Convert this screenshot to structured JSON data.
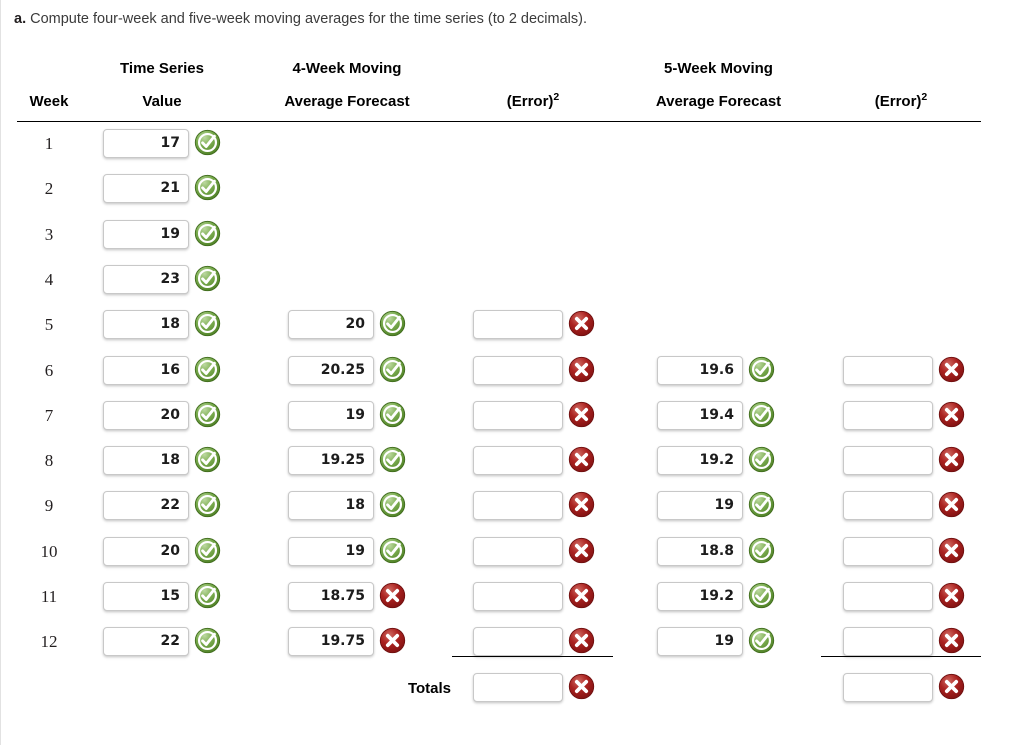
{
  "prompt": {
    "label": "a.",
    "text": "Compute four-week and five-week moving averages for the time series (to 2 decimals)."
  },
  "table": {
    "headers": {
      "week": "Week",
      "series_top": "Time Series",
      "series_bottom": "Value",
      "ma4_top": "4-Week Moving",
      "ma4_bottom": "Average Forecast",
      "err4_base": "(Error)",
      "err4_sup": "2",
      "ma5_top": "5-Week Moving",
      "ma5_bottom": "Average Forecast",
      "err5_base": "(Error)",
      "err5_sup": "2"
    },
    "totals_label": "Totals",
    "rows": [
      {
        "week": "1",
        "value": "17",
        "value_status": "correct",
        "ma4": null,
        "ma4_status": null,
        "err4": null,
        "err4_status": null,
        "ma5": null,
        "ma5_status": null,
        "err5": null,
        "err5_status": null
      },
      {
        "week": "2",
        "value": "21",
        "value_status": "correct",
        "ma4": null,
        "ma4_status": null,
        "err4": null,
        "err4_status": null,
        "ma5": null,
        "ma5_status": null,
        "err5": null,
        "err5_status": null
      },
      {
        "week": "3",
        "value": "19",
        "value_status": "correct",
        "ma4": null,
        "ma4_status": null,
        "err4": null,
        "err4_status": null,
        "ma5": null,
        "ma5_status": null,
        "err5": null,
        "err5_status": null
      },
      {
        "week": "4",
        "value": "23",
        "value_status": "correct",
        "ma4": null,
        "ma4_status": null,
        "err4": null,
        "err4_status": null,
        "ma5": null,
        "ma5_status": null,
        "err5": null,
        "err5_status": null
      },
      {
        "week": "5",
        "value": "18",
        "value_status": "correct",
        "ma4": "20",
        "ma4_status": "correct",
        "err4": "",
        "err4_status": "incorrect",
        "ma5": null,
        "ma5_status": null,
        "err5": null,
        "err5_status": null
      },
      {
        "week": "6",
        "value": "16",
        "value_status": "correct",
        "ma4": "20.25",
        "ma4_status": "correct",
        "err4": "",
        "err4_status": "incorrect",
        "ma5": "19.6",
        "ma5_status": "correct",
        "err5": "",
        "err5_status": "incorrect"
      },
      {
        "week": "7",
        "value": "20",
        "value_status": "correct",
        "ma4": "19",
        "ma4_status": "correct",
        "err4": "",
        "err4_status": "incorrect",
        "ma5": "19.4",
        "ma5_status": "correct",
        "err5": "",
        "err5_status": "incorrect"
      },
      {
        "week": "8",
        "value": "18",
        "value_status": "correct",
        "ma4": "19.25",
        "ma4_status": "correct",
        "err4": "",
        "err4_status": "incorrect",
        "ma5": "19.2",
        "ma5_status": "correct",
        "err5": "",
        "err5_status": "incorrect"
      },
      {
        "week": "9",
        "value": "22",
        "value_status": "correct",
        "ma4": "18",
        "ma4_status": "correct",
        "err4": "",
        "err4_status": "incorrect",
        "ma5": "19",
        "ma5_status": "correct",
        "err5": "",
        "err5_status": "incorrect"
      },
      {
        "week": "10",
        "value": "20",
        "value_status": "correct",
        "ma4": "19",
        "ma4_status": "correct",
        "err4": "",
        "err4_status": "incorrect",
        "ma5": "18.8",
        "ma5_status": "correct",
        "err5": "",
        "err5_status": "incorrect"
      },
      {
        "week": "11",
        "value": "15",
        "value_status": "correct",
        "ma4": "18.75",
        "ma4_status": "incorrect",
        "err4": "",
        "err4_status": "incorrect",
        "ma5": "19.2",
        "ma5_status": "correct",
        "err5": "",
        "err5_status": "incorrect"
      },
      {
        "week": "12",
        "value": "22",
        "value_status": "correct",
        "ma4": "19.75",
        "ma4_status": "incorrect",
        "err4": "",
        "err4_status": "incorrect",
        "ma5": "19",
        "ma5_status": "correct",
        "err5": "",
        "err5_status": "incorrect"
      }
    ],
    "totals": {
      "err4": "",
      "err4_status": "incorrect",
      "err5": "",
      "err5_status": "incorrect"
    }
  },
  "colors": {
    "correct": "#4b8b27",
    "incorrect": "#a31818",
    "rule": "#000000",
    "text": "#231f20",
    "prompt_text": "#3b3b3b"
  },
  "icons": {
    "correct": "check-circle-icon",
    "incorrect": "x-circle-icon"
  }
}
